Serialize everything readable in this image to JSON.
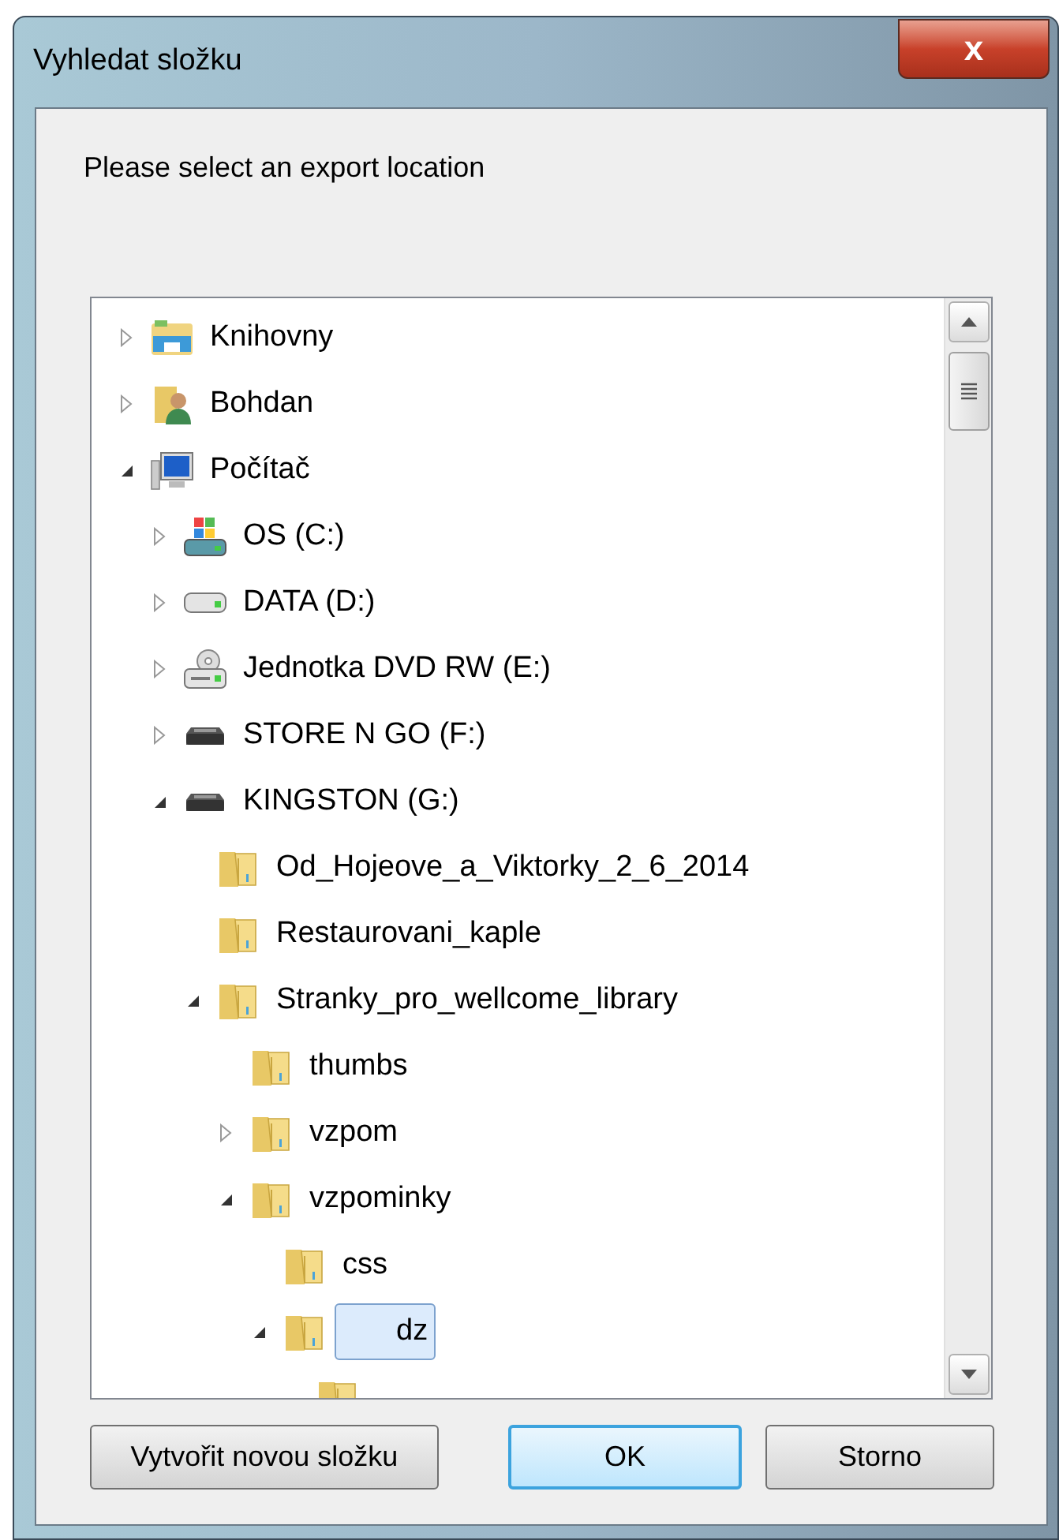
{
  "window": {
    "title": "Vyhledat složku",
    "close": "x"
  },
  "prompt": "Please select an export location",
  "tree": [
    {
      "label": "Knihovny",
      "kind": "library",
      "expanded": false,
      "selected": false
    },
    {
      "label": "Bohdan",
      "kind": "user",
      "expanded": false,
      "selected": false
    },
    {
      "label": "Počítač",
      "kind": "computer",
      "expanded": true,
      "selected": false,
      "children": [
        {
          "label": "OS (C:)",
          "kind": "os-drive",
          "expanded": false,
          "selected": false
        },
        {
          "label": "DATA (D:)",
          "kind": "drive",
          "expanded": false,
          "selected": false
        },
        {
          "label": "Jednotka DVD RW (E:)",
          "kind": "dvd",
          "expanded": false,
          "selected": false
        },
        {
          "label": "STORE N GO (F:)",
          "kind": "usb",
          "expanded": false,
          "selected": false
        },
        {
          "label": "KINGSTON (G:)",
          "kind": "usb",
          "expanded": true,
          "selected": false,
          "children": [
            {
              "label": "Od_Hojeove_a_Viktorky_2_6_2014",
              "kind": "folder",
              "selected": false
            },
            {
              "label": "Restaurovani_kaple",
              "kind": "folder",
              "selected": false
            },
            {
              "label": "Stranky_pro_wellcome_library",
              "kind": "folder",
              "expanded": true,
              "selected": false,
              "children": [
                {
                  "label": "thumbs",
                  "kind": "folder",
                  "selected": false
                },
                {
                  "label": "vzpom",
                  "kind": "folder",
                  "expanded": false,
                  "selected": false
                },
                {
                  "label": "vzpominky",
                  "kind": "folder",
                  "expanded": true,
                  "selected": false,
                  "children": [
                    {
                      "label": "css",
                      "kind": "folder",
                      "selected": false
                    },
                    {
                      "label": "dz",
                      "kind": "folder",
                      "expanded": true,
                      "selected": true,
                      "children": [
                        {
                          "kind": "folder"
                        }
                      ]
                    }
                  ]
                }
              ]
            }
          ]
        }
      ]
    }
  ],
  "buttons": [
    {
      "label": "Vytvořit novou složku",
      "default": false
    },
    {
      "label": "OK",
      "default": true
    },
    {
      "label": "Storno",
      "default": false
    }
  ]
}
